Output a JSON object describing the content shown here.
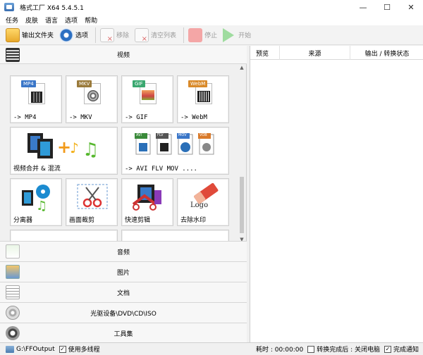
{
  "window": {
    "title": "格式工厂 X64 5.4.5.1",
    "minimize": "—",
    "maximize": "☐",
    "close": "✕"
  },
  "menu": [
    "任务",
    "皮肤",
    "语言",
    "选项",
    "帮助"
  ],
  "toolbar": {
    "output_folder": "输出文件夹",
    "options": "选项",
    "remove": "移除",
    "clear_list": "清空列表",
    "stop": "停止",
    "start": "开始"
  },
  "categories": {
    "video": "视频",
    "audio": "音频",
    "image": "图片",
    "document": "文档",
    "dvd": "光驱设备\\DVD\\CD\\ISO",
    "tools": "工具集"
  },
  "video_tiles": {
    "mp4": {
      "badge": "MP4",
      "label": "-> MP4",
      "color": "#3a76c8"
    },
    "mkv": {
      "badge": "MKV",
      "label": "-> MKV",
      "color": "#9a7a3a"
    },
    "gif": {
      "badge": "GIF",
      "label": "-> GIF",
      "color": "#3aa870"
    },
    "webm": {
      "badge": "WebM",
      "label": "-> WebM",
      "color": "#d98a2a"
    },
    "merge": {
      "label": "视频合并 & 混流"
    },
    "multi": {
      "label": "-> AVI FLV MOV ....",
      "badges": [
        "AVI",
        "FLV",
        "MOV",
        "VOB"
      ]
    },
    "splitter": {
      "label": "分离器"
    },
    "crop": {
      "label": "画面裁剪"
    },
    "quick_cut": {
      "label": "快速剪辑"
    },
    "remove_watermark": {
      "label": "去除水印",
      "logo_text": "Logo"
    }
  },
  "task_list": {
    "columns": [
      "预览",
      "来源",
      "输出 / 转换状态"
    ]
  },
  "statusbar": {
    "output_path": "G:\\FFOutput",
    "multithread": "使用多线程",
    "elapsed": "耗时 : 00:00:00",
    "after_convert": "转换完成后 : 关闭电脑",
    "notify": "完成通知"
  }
}
